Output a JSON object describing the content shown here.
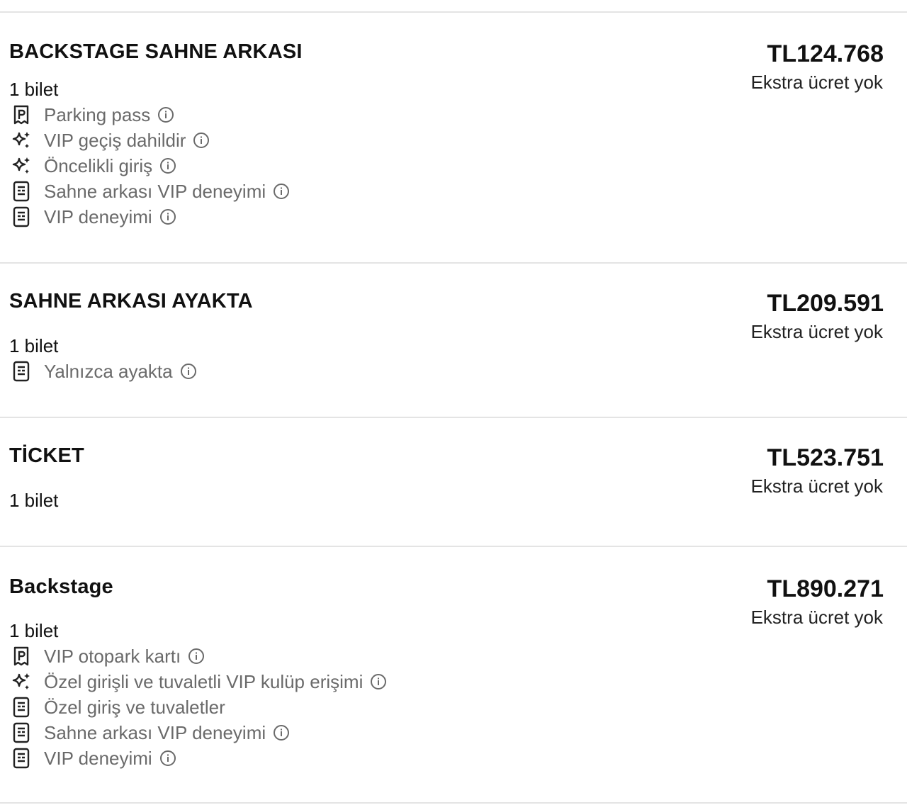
{
  "listings": [
    {
      "title": "BACKSTAGE SAHNE ARKASI",
      "price": "TL124.768",
      "fee_note": "Ekstra ücret yok",
      "quantity": "1 bilet",
      "features": [
        {
          "icon": "parking-icon",
          "label": "Parking pass",
          "info": true
        },
        {
          "icon": "sparkle-icon",
          "label": "VIP geçiş dahildir",
          "info": true
        },
        {
          "icon": "sparkle-icon",
          "label": "Öncelikli giriş",
          "info": true
        },
        {
          "icon": "document-icon",
          "label": "Sahne arkası VIP deneyimi",
          "info": true
        },
        {
          "icon": "document-icon",
          "label": "VIP deneyimi",
          "info": true
        }
      ]
    },
    {
      "title": "SAHNE ARKASI AYAKTA",
      "price": "TL209.591",
      "fee_note": "Ekstra ücret yok",
      "quantity": "1 bilet",
      "features": [
        {
          "icon": "document-icon",
          "label": "Yalnızca ayakta",
          "info": true
        }
      ]
    },
    {
      "title": "TİCKET",
      "price": "TL523.751",
      "fee_note": "Ekstra ücret yok",
      "quantity": "1 bilet",
      "features": []
    },
    {
      "title": "Backstage",
      "price": "TL890.271",
      "fee_note": "Ekstra ücret yok",
      "quantity": "1 bilet",
      "features": [
        {
          "icon": "parking-icon",
          "label": "VIP otopark kartı",
          "info": true
        },
        {
          "icon": "sparkle-icon",
          "label": "Özel girişli ve tuvaletli VIP kulüp erişimi",
          "info": true
        },
        {
          "icon": "document-icon",
          "label": "Özel giriş ve tuvaletler",
          "info": false
        },
        {
          "icon": "document-icon",
          "label": "Sahne arkası VIP deneyimi",
          "info": true
        },
        {
          "icon": "document-icon",
          "label": "VIP deneyimi",
          "info": true
        }
      ]
    }
  ],
  "colors": {
    "text_primary": "#111111",
    "text_feature": "#6a6a6a",
    "divider": "#e4e4e4"
  }
}
